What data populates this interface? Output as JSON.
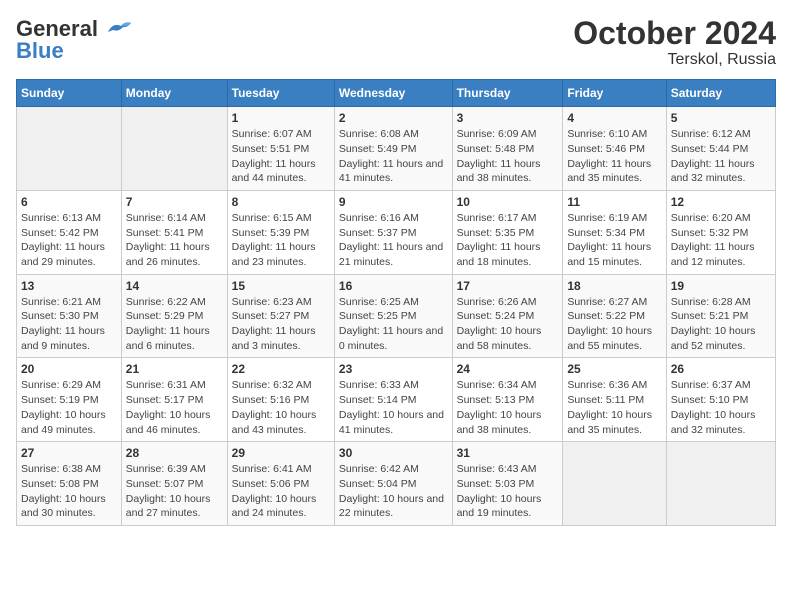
{
  "logo": {
    "text_general": "General",
    "text_blue": "Blue"
  },
  "title": "October 2024",
  "subtitle": "Terskol, Russia",
  "days_of_week": [
    "Sunday",
    "Monday",
    "Tuesday",
    "Wednesday",
    "Thursday",
    "Friday",
    "Saturday"
  ],
  "weeks": [
    [
      {
        "day": "",
        "empty": true
      },
      {
        "day": "",
        "empty": true
      },
      {
        "day": "1",
        "sunrise": "Sunrise: 6:07 AM",
        "sunset": "Sunset: 5:51 PM",
        "daylight": "Daylight: 11 hours and 44 minutes."
      },
      {
        "day": "2",
        "sunrise": "Sunrise: 6:08 AM",
        "sunset": "Sunset: 5:49 PM",
        "daylight": "Daylight: 11 hours and 41 minutes."
      },
      {
        "day": "3",
        "sunrise": "Sunrise: 6:09 AM",
        "sunset": "Sunset: 5:48 PM",
        "daylight": "Daylight: 11 hours and 38 minutes."
      },
      {
        "day": "4",
        "sunrise": "Sunrise: 6:10 AM",
        "sunset": "Sunset: 5:46 PM",
        "daylight": "Daylight: 11 hours and 35 minutes."
      },
      {
        "day": "5",
        "sunrise": "Sunrise: 6:12 AM",
        "sunset": "Sunset: 5:44 PM",
        "daylight": "Daylight: 11 hours and 32 minutes."
      }
    ],
    [
      {
        "day": "6",
        "sunrise": "Sunrise: 6:13 AM",
        "sunset": "Sunset: 5:42 PM",
        "daylight": "Daylight: 11 hours and 29 minutes."
      },
      {
        "day": "7",
        "sunrise": "Sunrise: 6:14 AM",
        "sunset": "Sunset: 5:41 PM",
        "daylight": "Daylight: 11 hours and 26 minutes."
      },
      {
        "day": "8",
        "sunrise": "Sunrise: 6:15 AM",
        "sunset": "Sunset: 5:39 PM",
        "daylight": "Daylight: 11 hours and 23 minutes."
      },
      {
        "day": "9",
        "sunrise": "Sunrise: 6:16 AM",
        "sunset": "Sunset: 5:37 PM",
        "daylight": "Daylight: 11 hours and 21 minutes."
      },
      {
        "day": "10",
        "sunrise": "Sunrise: 6:17 AM",
        "sunset": "Sunset: 5:35 PM",
        "daylight": "Daylight: 11 hours and 18 minutes."
      },
      {
        "day": "11",
        "sunrise": "Sunrise: 6:19 AM",
        "sunset": "Sunset: 5:34 PM",
        "daylight": "Daylight: 11 hours and 15 minutes."
      },
      {
        "day": "12",
        "sunrise": "Sunrise: 6:20 AM",
        "sunset": "Sunset: 5:32 PM",
        "daylight": "Daylight: 11 hours and 12 minutes."
      }
    ],
    [
      {
        "day": "13",
        "sunrise": "Sunrise: 6:21 AM",
        "sunset": "Sunset: 5:30 PM",
        "daylight": "Daylight: 11 hours and 9 minutes."
      },
      {
        "day": "14",
        "sunrise": "Sunrise: 6:22 AM",
        "sunset": "Sunset: 5:29 PM",
        "daylight": "Daylight: 11 hours and 6 minutes."
      },
      {
        "day": "15",
        "sunrise": "Sunrise: 6:23 AM",
        "sunset": "Sunset: 5:27 PM",
        "daylight": "Daylight: 11 hours and 3 minutes."
      },
      {
        "day": "16",
        "sunrise": "Sunrise: 6:25 AM",
        "sunset": "Sunset: 5:25 PM",
        "daylight": "Daylight: 11 hours and 0 minutes."
      },
      {
        "day": "17",
        "sunrise": "Sunrise: 6:26 AM",
        "sunset": "Sunset: 5:24 PM",
        "daylight": "Daylight: 10 hours and 58 minutes."
      },
      {
        "day": "18",
        "sunrise": "Sunrise: 6:27 AM",
        "sunset": "Sunset: 5:22 PM",
        "daylight": "Daylight: 10 hours and 55 minutes."
      },
      {
        "day": "19",
        "sunrise": "Sunrise: 6:28 AM",
        "sunset": "Sunset: 5:21 PM",
        "daylight": "Daylight: 10 hours and 52 minutes."
      }
    ],
    [
      {
        "day": "20",
        "sunrise": "Sunrise: 6:29 AM",
        "sunset": "Sunset: 5:19 PM",
        "daylight": "Daylight: 10 hours and 49 minutes."
      },
      {
        "day": "21",
        "sunrise": "Sunrise: 6:31 AM",
        "sunset": "Sunset: 5:17 PM",
        "daylight": "Daylight: 10 hours and 46 minutes."
      },
      {
        "day": "22",
        "sunrise": "Sunrise: 6:32 AM",
        "sunset": "Sunset: 5:16 PM",
        "daylight": "Daylight: 10 hours and 43 minutes."
      },
      {
        "day": "23",
        "sunrise": "Sunrise: 6:33 AM",
        "sunset": "Sunset: 5:14 PM",
        "daylight": "Daylight: 10 hours and 41 minutes."
      },
      {
        "day": "24",
        "sunrise": "Sunrise: 6:34 AM",
        "sunset": "Sunset: 5:13 PM",
        "daylight": "Daylight: 10 hours and 38 minutes."
      },
      {
        "day": "25",
        "sunrise": "Sunrise: 6:36 AM",
        "sunset": "Sunset: 5:11 PM",
        "daylight": "Daylight: 10 hours and 35 minutes."
      },
      {
        "day": "26",
        "sunrise": "Sunrise: 6:37 AM",
        "sunset": "Sunset: 5:10 PM",
        "daylight": "Daylight: 10 hours and 32 minutes."
      }
    ],
    [
      {
        "day": "27",
        "sunrise": "Sunrise: 6:38 AM",
        "sunset": "Sunset: 5:08 PM",
        "daylight": "Daylight: 10 hours and 30 minutes."
      },
      {
        "day": "28",
        "sunrise": "Sunrise: 6:39 AM",
        "sunset": "Sunset: 5:07 PM",
        "daylight": "Daylight: 10 hours and 27 minutes."
      },
      {
        "day": "29",
        "sunrise": "Sunrise: 6:41 AM",
        "sunset": "Sunset: 5:06 PM",
        "daylight": "Daylight: 10 hours and 24 minutes."
      },
      {
        "day": "30",
        "sunrise": "Sunrise: 6:42 AM",
        "sunset": "Sunset: 5:04 PM",
        "daylight": "Daylight: 10 hours and 22 minutes."
      },
      {
        "day": "31",
        "sunrise": "Sunrise: 6:43 AM",
        "sunset": "Sunset: 5:03 PM",
        "daylight": "Daylight: 10 hours and 19 minutes."
      },
      {
        "day": "",
        "empty": true
      },
      {
        "day": "",
        "empty": true
      }
    ]
  ]
}
